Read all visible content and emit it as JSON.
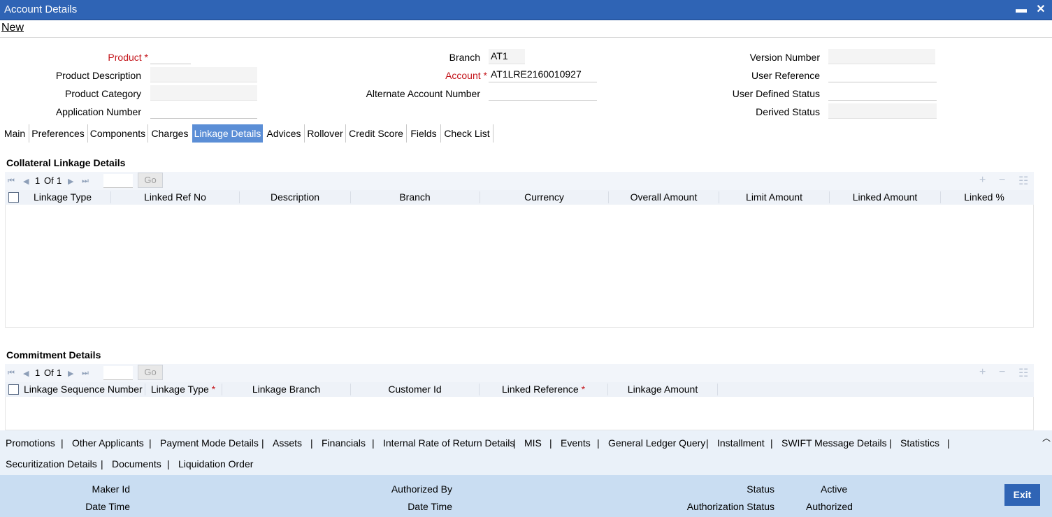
{
  "window": {
    "title": "Account Details",
    "minimize_label": "▬",
    "close_label": "✕"
  },
  "toolbar": {
    "new_label": "New"
  },
  "header": {
    "product": {
      "label": "Product",
      "value": ""
    },
    "product_description": {
      "label": "Product Description",
      "value": ""
    },
    "product_category": {
      "label": "Product Category",
      "value": ""
    },
    "application_number": {
      "label": "Application Number",
      "value": ""
    },
    "branch": {
      "label": "Branch",
      "value": "AT1"
    },
    "account": {
      "label": "Account",
      "value": "AT1LRE2160010927"
    },
    "alternate_account_number": {
      "label": "Alternate Account Number",
      "value": ""
    },
    "version_number": {
      "label": "Version Number",
      "value": ""
    },
    "user_reference": {
      "label": "User Reference",
      "value": ""
    },
    "user_defined_status": {
      "label": "User Defined Status",
      "value": ""
    },
    "derived_status": {
      "label": "Derived Status",
      "value": ""
    }
  },
  "tabs": [
    "Main",
    "Preferences",
    "Components",
    "Charges",
    "Linkage Details",
    "Advices",
    "Rollover",
    "Credit Score",
    "Fields",
    "Check List"
  ],
  "active_tab": "Linkage Details",
  "collateral": {
    "title": "Collateral Linkage Details",
    "pager": {
      "page": "1",
      "of_label": "Of",
      "total": "1",
      "go_label": "Go"
    },
    "columns": [
      "Linkage Type",
      "Linked Ref No",
      "Description",
      "Branch",
      "Currency",
      "Overall Amount",
      "Limit Amount",
      "Linked Amount",
      "Linked %"
    ],
    "rows": []
  },
  "commitment": {
    "title": "Commitment Details",
    "pager": {
      "page": "1",
      "of_label": "Of",
      "total": "1",
      "go_label": "Go"
    },
    "columns": [
      "Linkage Sequence Number",
      "Linkage Type",
      "Linkage Branch",
      "Customer Id",
      "Linked Reference",
      "Linkage Amount"
    ],
    "rows": []
  },
  "bottom_links": {
    "row1": [
      "Promotions",
      "Other Applicants",
      "Payment Mode Details",
      "Assets",
      "Financials",
      "Internal Rate of Return Details",
      "MIS",
      "Events",
      "General Ledger Query",
      "Installment",
      "SWIFT Message Details",
      "Statistics"
    ],
    "row2": [
      "Securitization Details",
      "Documents",
      "Liquidation Order"
    ]
  },
  "footer": {
    "maker_id_label": "Maker Id",
    "maker_id": "",
    "maker_datetime_label": "Date Time",
    "maker_datetime": "",
    "authorized_by_label": "Authorized By",
    "authorized_by": "",
    "auth_datetime_label": "Date Time",
    "auth_datetime": "",
    "status_label": "Status",
    "status": "Active",
    "auth_status_label": "Authorization Status",
    "auth_status": "Authorized",
    "exit_label": "Exit"
  },
  "colors": {
    "title_bar": "#2f64b5",
    "active_tab": "#5b8ed6",
    "footer": "#c9ddf2",
    "required": "#c4161c"
  },
  "icons": [
    "minimize-icon",
    "close-icon",
    "first-page-icon",
    "prev-page-icon",
    "next-page-icon",
    "last-page-icon",
    "add-row-icon",
    "delete-row-icon",
    "single-view-icon",
    "collapse-icon"
  ]
}
